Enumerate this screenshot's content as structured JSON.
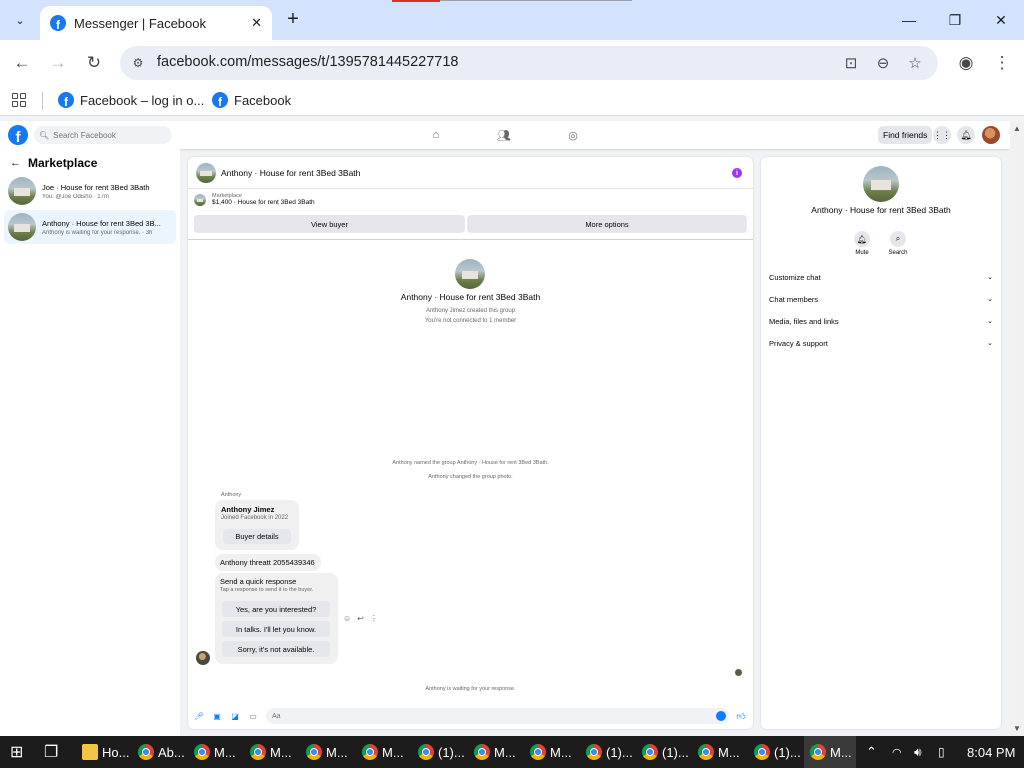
{
  "browser": {
    "tab_title": "Messenger | Facebook",
    "url": "facebook.com/messages/t/1395781445227718",
    "bookmarks": [
      "Facebook – log in o...",
      "Facebook"
    ]
  },
  "fb_header": {
    "search_placeholder": "Search Facebook",
    "find_friends": "Find friends"
  },
  "sidebar": {
    "title": "Marketplace",
    "chats": [
      {
        "name": "Joe · House for rent 3Bed 3Bath",
        "snippet": "You: @Joe Odisho · 17m"
      },
      {
        "name": "Anthony · House for rent 3Bed 3B...",
        "snippet": "Anthony is waiting for your response. · 3h"
      }
    ]
  },
  "conversation": {
    "title": "Anthony · House for rent 3Bed 3Bath",
    "marketplace_label": "Marketplace",
    "listing": "$1,400 · House for rent 3Bed 3Bath",
    "view_buyer": "View buyer",
    "more_options": "More options",
    "group_name": "Anthony · House for rent 3Bed 3Bath",
    "group_created": "Anthony Jimez created this group",
    "group_connected": "You're not connected to 1 member",
    "sys_named": "Anthony named the group Anthony · House for rent 3Bed 3Bath.",
    "sys_photo": "Anthony changed the group photo.",
    "sender_label": "Anthony",
    "buyer_name": "Anthony Jimez",
    "buyer_joined": "Joined Facebook in 2022",
    "buyer_details": "Buyer details",
    "message_text": "Anthony threatt 2055439346",
    "quick_title": "Send a quick response",
    "quick_sub": "Tap a response to send it to the buyer.",
    "quick_replies": [
      "Yes, are you interested?",
      "In talks. I'll let you know.",
      "Sorry, it's not available."
    ],
    "waiting": "Anthony is waiting for your response.",
    "composer_placeholder": "Aa"
  },
  "details": {
    "name": "Anthony · House for rent 3Bed 3Bath",
    "actions": [
      "Mute",
      "Search"
    ],
    "sections": [
      "Customize chat",
      "Chat members",
      "Media, files and links",
      "Privacy & support"
    ]
  },
  "taskbar": {
    "items": [
      "Ho...",
      "Ab...",
      "M...",
      "M...",
      "M...",
      "M...",
      "(1)...",
      "M...",
      "M...",
      "(1)...",
      "(1)...",
      "M...",
      "(1)...",
      "M..."
    ],
    "time": "8:04 PM"
  },
  "colors": {
    "fb_blue": "#1877f2",
    "messenger_blue": "#0a7cff",
    "info_purple": "#a033ff",
    "chrome_tabstrip": "#d3e3fd"
  }
}
